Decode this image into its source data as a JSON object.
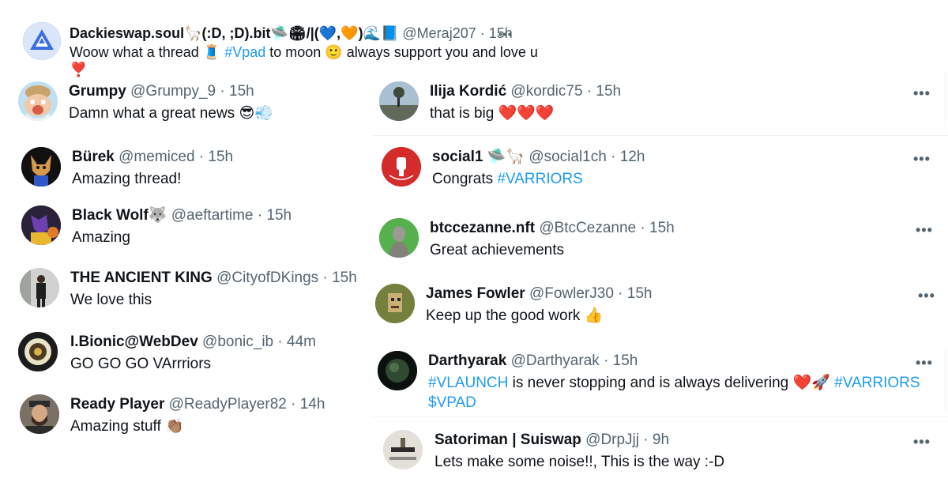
{
  "top": {
    "name": "Dackieswap.soul🦙(:D, ;D).bit🛸🏟/|(💙,🧡)🌊📘",
    "handle": "@Meraj207",
    "time": "15h",
    "text_pre": "Woow what a thread 🧵",
    "hashtag": "#Vpad",
    "text_post": "to moon 🙂 always support you and love u",
    "text_line2": "❣️"
  },
  "left": [
    {
      "name": "Grumpy",
      "handle": "@Grumpy_9",
      "time": "15h",
      "text": "Damn what a great news 😎💨"
    },
    {
      "name": "Bürek",
      "handle": "@memiced",
      "time": "15h",
      "text": "Amazing thread!"
    },
    {
      "name": "Black Wolf🐺",
      "handle": "@aeftartime",
      "time": "15h",
      "text": "Amazing"
    },
    {
      "name": "THE ANCIENT KING",
      "handle": "@CityofDKings",
      "time": "15h",
      "text": "We love this"
    },
    {
      "name": "I.Bionic@WebDev",
      "handle": "@bonic_ib",
      "time": "44m",
      "text": "GO GO GO VArrriors"
    },
    {
      "name": "Ready Player",
      "handle": "@ReadyPlayer82",
      "time": "14h",
      "text": "Amazing stuff 👏🏽"
    }
  ],
  "right": [
    {
      "name": "Ilija Kordić",
      "handle": "@kordic75",
      "time": "15h",
      "text": "that is big ❤️❤️❤️"
    },
    {
      "name": "social1 🛸🦙",
      "handle": "@social1ch",
      "time": "12h",
      "text_pre": "Congrats",
      "hashtag": "#VARRIORS"
    },
    {
      "name": "btccezanne.nft",
      "handle": "@BtcCezanne",
      "time": "15h",
      "text": "Great achievements"
    },
    {
      "name": "James Fowler",
      "handle": "@FowlerJ30",
      "time": "15h",
      "text": "Keep up the good work 👍"
    },
    {
      "name": "Darthyarak",
      "handle": "@Darthyarak",
      "time": "15h",
      "hashtag1": "#VLAUNCH",
      "text_mid": "is never stopping and is always delivering ❤️🚀",
      "hashtag2": "#VARRIORS",
      "cashtag": "$VPAD"
    },
    {
      "name": "Satoriman | Suiswap",
      "handle": "@DrpJjj",
      "time": "9h",
      "text": "Lets make some noise!!, This is the way :-D"
    }
  ],
  "separator": "·",
  "more_glyph": "•••",
  "colors": {
    "link": "#1d9bf0",
    "muted": "#536471",
    "text": "#0f1419"
  }
}
